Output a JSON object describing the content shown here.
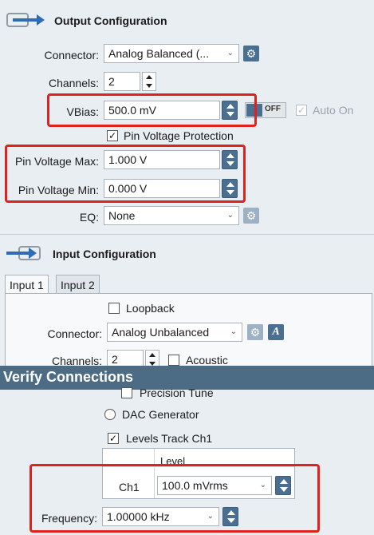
{
  "output": {
    "title": "Output Configuration",
    "connector_label": "Connector:",
    "connector_value": "Analog Balanced (...",
    "channels_label": "Channels:",
    "channels_value": "2",
    "vbias_label": "VBias:",
    "vbias_value": "500.0 mV",
    "vbias_toggle": "OFF",
    "auto_on_label": "Auto On",
    "pin_protection_label": "Pin Voltage Protection",
    "pin_max_label": "Pin Voltage Max:",
    "pin_max_value": "1.000 V",
    "pin_min_label": "Pin Voltage Min:",
    "pin_min_value": "0.000 V",
    "eq_label": "EQ:",
    "eq_value": "None"
  },
  "input": {
    "title": "Input Configuration",
    "tabs": [
      "Input 1",
      "Input 2"
    ],
    "loopback_label": "Loopback",
    "connector_label": "Connector:",
    "connector_value": "Analog Unbalanced",
    "channels_label": "Channels:",
    "channels_value": "2",
    "acoustic_label": "Acoustic"
  },
  "verify": {
    "title": "Verify Connections",
    "precision_tune_label": "Precision Tune",
    "dac_generator_label": "DAC Generator",
    "levels_track_label": "Levels Track Ch1",
    "table_header": "Level",
    "row_label": "Ch1",
    "row_value": "100.0 mVrms",
    "frequency_label": "Frequency:",
    "frequency_value": "1.00000 kHz"
  },
  "icons": {
    "output_icon": "arrow-into-box-icon",
    "input_icon": "arrow-into-box-icon",
    "gear": "gear-icon",
    "a_icon": "a-format-icon"
  },
  "colors": {
    "accent": "#4a6f90",
    "highlight": "#e0211c",
    "banner": "#4c6b85"
  }
}
